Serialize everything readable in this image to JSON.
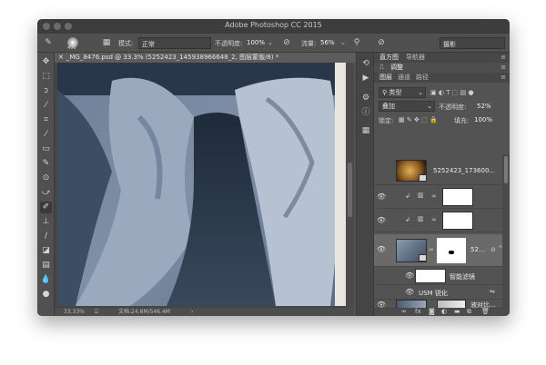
{
  "window": {
    "title": "Adobe Photoshop CC 2015"
  },
  "options_bar": {
    "brush_size": "400",
    "mode_label": "模式:",
    "mode_value": "正常",
    "opacity_label": "不透明度:",
    "opacity_value": "100%",
    "flow_label": "流量:",
    "flow_value": "56%",
    "workspace_value": "摄影"
  },
  "document": {
    "tab_title": "_MG_8476.psd @ 33.3% (5252423_145938966648_2, 图层蒙版/8) *",
    "zoom": "33.33%",
    "doc_size": "文档:24.6M/546.4M"
  },
  "panels": {
    "tabs_top": [
      "直方图",
      "导航器"
    ],
    "tabs_mid": [
      "调整"
    ],
    "tabs_layers": [
      "图层",
      "通道",
      "路径"
    ],
    "kind_filter": "类型",
    "blend_mode": "叠加",
    "opacity_label": "不透明度:",
    "opacity_value": "52%",
    "lock_label": "锁定:",
    "fill_label": "填充:",
    "fill_value": "100%"
  },
  "layers": [
    {
      "name": "5252423_173600..."
    },
    {
      "name": ""
    },
    {
      "name": ""
    },
    {
      "name": "52..."
    },
    {
      "name": "智能滤镜"
    },
    {
      "name": "USM 锐化"
    },
    {
      "name": "液对比..."
    }
  ]
}
